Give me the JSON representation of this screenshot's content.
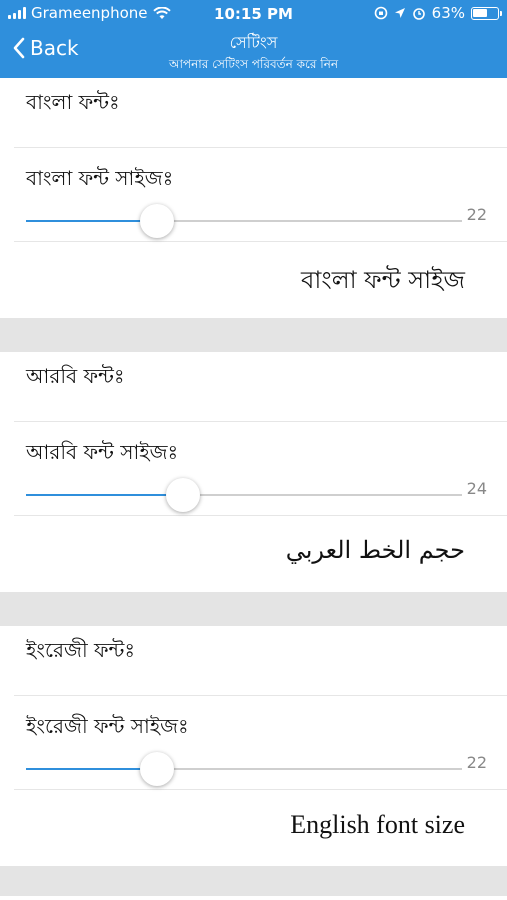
{
  "status": {
    "carrier": "Grameenphone",
    "time": "10:15 PM",
    "battery": "63%",
    "battery_level": 0.63
  },
  "nav": {
    "back_label": "Back",
    "title": "সেটিংস",
    "subtitle": "আপনার সেটিংস পরিবর্তন করে নিন"
  },
  "sections": [
    {
      "font_label": "বাংলা ফন্টঃ",
      "size_label": "বাংলা ফন্ট সাইজঃ",
      "size_value": "22",
      "slider_fraction": 0.3,
      "preview": "বাংলা ফন্ট সাইজ"
    },
    {
      "font_label": "আরবি ফন্টঃ",
      "size_label": "আরবি ফন্ট সাইজঃ",
      "size_value": "24",
      "slider_fraction": 0.36,
      "preview": "حجم الخط العربي"
    },
    {
      "font_label": "ইংরেজী ফন্টঃ",
      "size_label": "ইংরেজী ফন্ট সাইজঃ",
      "size_value": "22",
      "slider_fraction": 0.3,
      "preview": "English font size"
    }
  ],
  "colors": {
    "accent": "#2f8fdc",
    "separator": "#e4e4e4"
  }
}
